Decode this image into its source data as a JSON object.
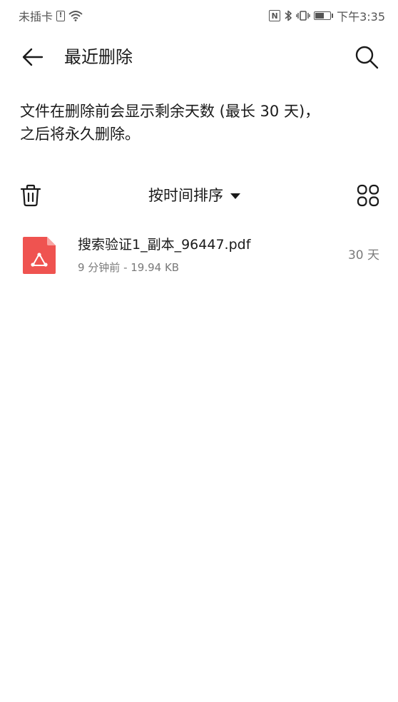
{
  "status_bar": {
    "carrier": "未插卡",
    "sim_label": "!",
    "nfc_label": "N",
    "time": "下午3:35"
  },
  "header": {
    "title": "最近删除"
  },
  "notice": {
    "line1": "文件在删除前会显示剩余天数 (最长 30 天)，",
    "line2": "之后将永久删除。"
  },
  "toolbar": {
    "sort_label": "按时间排序"
  },
  "files": [
    {
      "name": "搜索验证1_副本_96447.pdf",
      "meta": "9 分钟前 - 19.94 KB",
      "days_left": "30 天",
      "icon": "pdf-icon"
    }
  ],
  "colors": {
    "pdf_red": "#ef5350",
    "text_primary": "#1a1a1a",
    "text_secondary": "#7a7a7a"
  }
}
